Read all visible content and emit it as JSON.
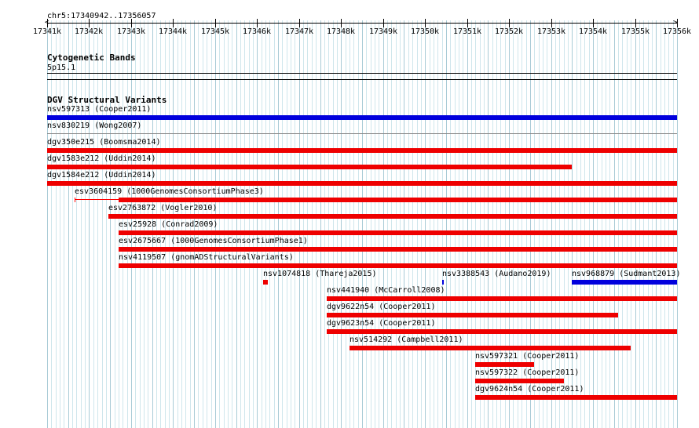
{
  "location_label": "chr5:17340942..17356057",
  "ruler": {
    "start": 17341,
    "end": 17356,
    "ticks": [
      "17341k",
      "17342k",
      "17343k",
      "17344k",
      "17345k",
      "17346k",
      "17347k",
      "17348k",
      "17349k",
      "17350k",
      "17351k",
      "17352k",
      "17353k",
      "17354k",
      "17355k",
      "17356k"
    ]
  },
  "tracks": {
    "cytoband": {
      "title": "Cytogenetic Bands",
      "band_label": "5p15.1"
    },
    "dgv": {
      "title": "DGV Structural Variants",
      "features": [
        {
          "label": "nsv597313 (Cooper2011)",
          "start": 17341,
          "end": 17356,
          "color": "#0000dd"
        },
        {
          "label": "nsv830219 (Wong2007)",
          "start": 17341,
          "end": 17356,
          "color": "",
          "separator": true
        },
        {
          "label": "dgv350e215 (Boomsma2014)",
          "start": 17341,
          "end": 17356,
          "color": "#ee0000"
        },
        {
          "label": "dgv1583e212 (Uddin2014)",
          "start": 17341,
          "end": 17353.5,
          "color": "#ee0000"
        },
        {
          "label": "dgv1584e212 (Uddin2014)",
          "start": 17341,
          "end": 17356,
          "color": "#ee0000"
        },
        {
          "label": "esv3604159 (1000GenomesConsortiumPhase3)",
          "start": 17342.7,
          "end": 17356,
          "color": "#ee0000",
          "whisker_start": 17341.65
        },
        {
          "label": "esv2763872 (Vogler2010)",
          "start": 17342.45,
          "end": 17356,
          "color": "#ee0000"
        },
        {
          "label": "esv25928 (Conrad2009)",
          "start": 17342.7,
          "end": 17356,
          "color": "#ee0000"
        },
        {
          "label": "esv2675667 (1000GenomesConsortiumPhase1)",
          "start": 17342.7,
          "end": 17356,
          "color": "#ee0000"
        },
        {
          "label": "nsv4119507 (gnomADStructuralVariants)",
          "start": 17342.7,
          "end": 17356,
          "color": "#ee0000"
        },
        {
          "label": "nsv1074818 (Thareja2015)",
          "start": 17346.15,
          "end": 17346.25,
          "color": "#ee0000"
        },
        {
          "label": "nsv3388543 (Audano2019)",
          "start": 17350.4,
          "end": 17350.45,
          "color": "#0000dd",
          "same_row_as_prev": true
        },
        {
          "label": "nsv968879 (Sudmant2013)",
          "start": 17353.5,
          "end": 17356,
          "color": "#0000dd",
          "same_row_as_prev": true
        },
        {
          "label": "nsv441940 (McCarroll2008)",
          "start": 17347.65,
          "end": 17356,
          "color": "#ee0000"
        },
        {
          "label": "dgv9622n54 (Cooper2011)",
          "start": 17347.65,
          "end": 17354.6,
          "color": "#ee0000"
        },
        {
          "label": "dgv9623n54 (Cooper2011)",
          "start": 17347.65,
          "end": 17356,
          "color": "#ee0000"
        },
        {
          "label": "nsv514292 (Campbell2011)",
          "start": 17348.2,
          "end": 17354.9,
          "color": "#ee0000"
        },
        {
          "label": "nsv597321 (Cooper2011)",
          "start": 17351.2,
          "end": 17352.6,
          "color": "#ee0000"
        },
        {
          "label": "nsv597322 (Cooper2011)",
          "start": 17351.2,
          "end": 17353.3,
          "color": "#ee0000"
        },
        {
          "label": "dgv9624n54 (Cooper2011)",
          "start": 17351.2,
          "end": 17356,
          "color": "#ee0000"
        }
      ]
    }
  }
}
